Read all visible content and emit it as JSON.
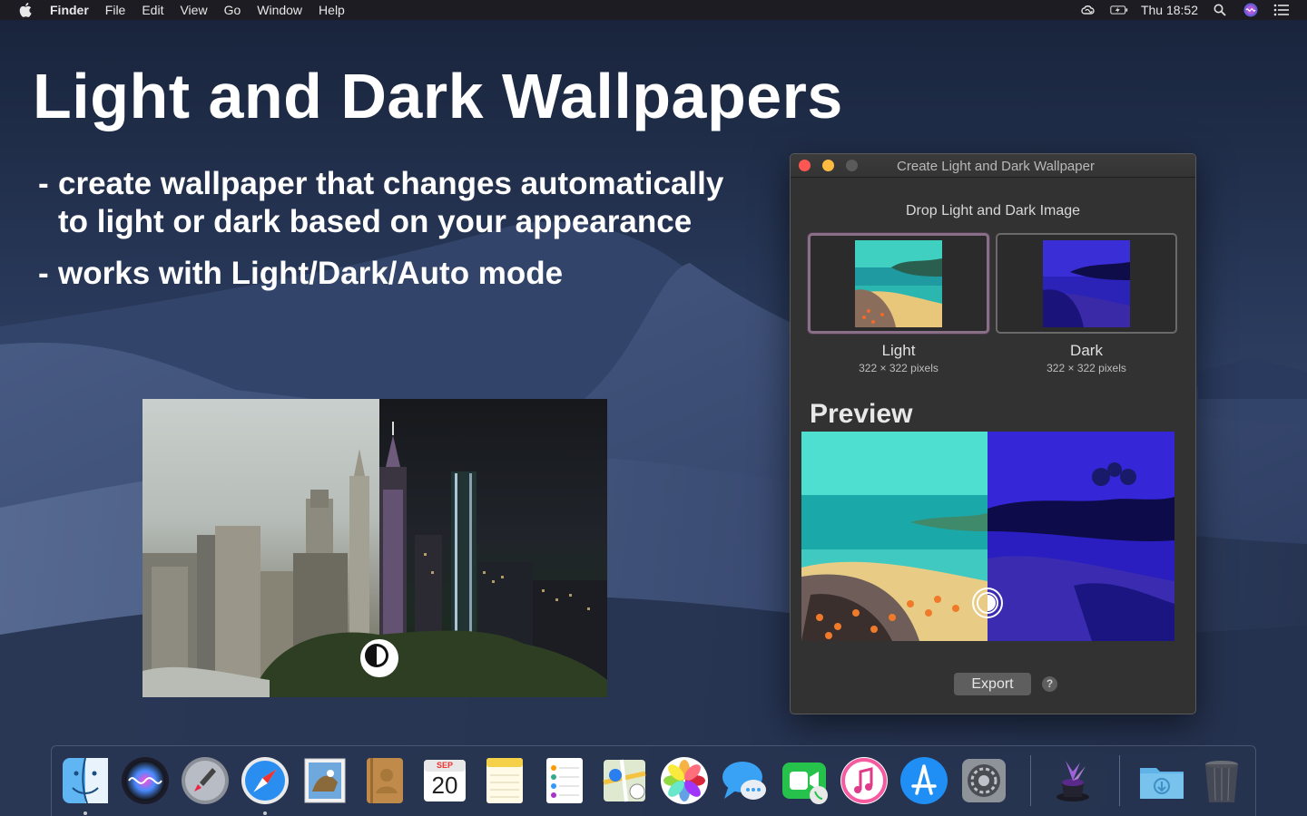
{
  "menubar": {
    "app": "Finder",
    "menus": [
      "File",
      "Edit",
      "View",
      "Go",
      "Window",
      "Help"
    ],
    "clock": "Thu 18:52"
  },
  "hero": {
    "headline": "Light and Dark Wallpapers",
    "bullet1_line1": "create wallpaper that changes automatically",
    "bullet1_line2": "to light or dark based on your appearance",
    "bullet2": "works with Light/Dark/Auto mode",
    "dash": "-"
  },
  "window": {
    "title": "Create Light and Dark Wallpaper",
    "drop_label": "Drop Light and Dark Image",
    "light_label": "Light",
    "light_size": "322 × 322 pixels",
    "dark_label": "Dark",
    "dark_size": "322 × 322 pixels",
    "preview_title": "Preview",
    "export_label": "Export",
    "help_label": "?"
  },
  "dock": {
    "calendar_month": "SEP",
    "calendar_day": "20"
  },
  "colors": {
    "close": "#fc5753",
    "minimize": "#fdbc40",
    "selected_well": "#8a6f88"
  }
}
